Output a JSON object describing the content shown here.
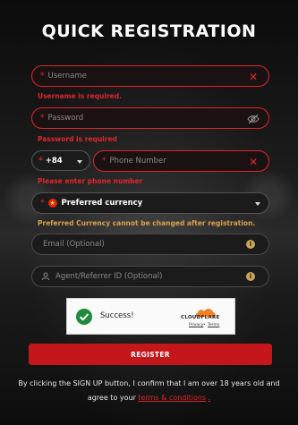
{
  "title": "QUICK REGISTRATION",
  "username": {
    "placeholder": "Username",
    "error": "Username is required."
  },
  "password": {
    "placeholder": "Password",
    "error": "Password is required"
  },
  "phone": {
    "country_code": "+84",
    "placeholder": "Phone Number",
    "error": "Please enter phone number"
  },
  "currency": {
    "value": "Preferred currency",
    "warning": "Preferred Currency cannot be changed after registration."
  },
  "email": {
    "placeholder": "Email (Optional)"
  },
  "referrer": {
    "placeholder": "Agent/Referrer ID (Optional)"
  },
  "captcha": {
    "status": "Success!",
    "brand": "CLOUDFLARE",
    "privacy": "Privacy",
    "sep": "•",
    "terms": "Terms"
  },
  "register_label": "REGISTER",
  "consent": {
    "line1": "By clicking the SIGN UP button, I confirm that I am over 18 years old and",
    "line2_prefix": "agree to your",
    "link": "terms & conditions",
    "suffix": "."
  },
  "colors": {
    "accent": "#e0262b",
    "button": "#c5161c",
    "warning": "#d8a24b"
  },
  "icons": [
    "clear-x-icon",
    "eye-off-icon",
    "flag-icon",
    "chevron-down-icon",
    "info-icon",
    "referrer-icon",
    "check-circle-icon",
    "cloudflare-logo"
  ]
}
